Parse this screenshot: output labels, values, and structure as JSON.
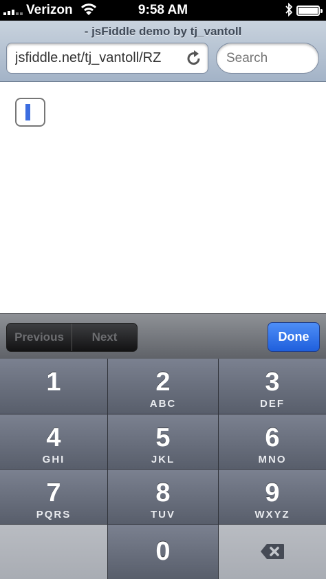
{
  "status_bar": {
    "carrier": "Verizon",
    "time": "9:58 AM",
    "icons": [
      "signal-icon",
      "wifi-icon",
      "bluetooth-icon",
      "battery-icon"
    ]
  },
  "browser": {
    "page_title": "- jsFiddle demo by tj_vantoll",
    "url": "jsfiddle.net/tj_vantoll/RZ",
    "search_placeholder": "Search"
  },
  "toolbar": {
    "previous_label": "Previous",
    "next_label": "Next",
    "done_label": "Done"
  },
  "keypad": {
    "keys": [
      {
        "num": "1",
        "letters": ""
      },
      {
        "num": "2",
        "letters": "ABC"
      },
      {
        "num": "3",
        "letters": "DEF"
      },
      {
        "num": "4",
        "letters": "GHI"
      },
      {
        "num": "5",
        "letters": "JKL"
      },
      {
        "num": "6",
        "letters": "MNO"
      },
      {
        "num": "7",
        "letters": "PQRS"
      },
      {
        "num": "8",
        "letters": "TUV"
      },
      {
        "num": "9",
        "letters": "WXYZ"
      },
      {
        "num": "0",
        "letters": ""
      }
    ]
  },
  "colors": {
    "done_button": "#1f5fdc",
    "caret": "#3c6de0",
    "status_bar": "#000000"
  }
}
